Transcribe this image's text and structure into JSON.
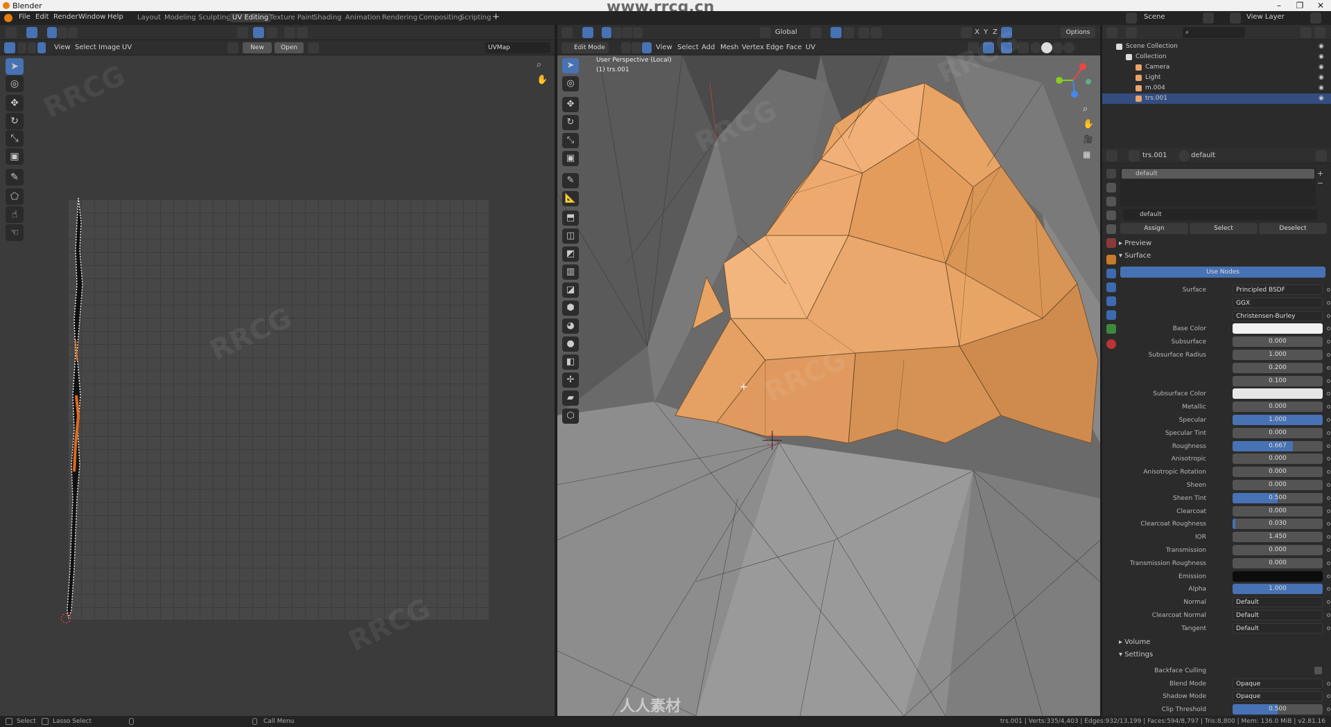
{
  "window": {
    "title": "Blender",
    "watermark_url": "www.rrcg.cn",
    "watermark_bottom": "人人素材"
  },
  "menu": [
    "File",
    "Edit",
    "Render",
    "Window",
    "Help"
  ],
  "workspaces": [
    {
      "label": "Layout",
      "active": false
    },
    {
      "label": "Modeling",
      "active": false
    },
    {
      "label": "Sculpting",
      "active": false
    },
    {
      "label": "UV Editing",
      "active": true
    },
    {
      "label": "Texture Paint",
      "active": false
    },
    {
      "label": "Shading",
      "active": false
    },
    {
      "label": "Animation",
      "active": false
    },
    {
      "label": "Rendering",
      "active": false
    },
    {
      "label": "Compositing",
      "active": false
    },
    {
      "label": "Scripting",
      "active": false
    }
  ],
  "scene": {
    "name": "Scene",
    "view_layer": "View Layer"
  },
  "uv_editor": {
    "menus": [
      "View",
      "Select",
      "Image",
      "UV"
    ],
    "new_label": "New",
    "open_label": "Open",
    "uvmap": "UVMap"
  },
  "viewport": {
    "mode": "Edit Mode",
    "menus": [
      "View",
      "Select",
      "Add",
      "Mesh",
      "Vertex",
      "Edge",
      "Face",
      "UV"
    ],
    "orientation": "Global",
    "options_label": "Options",
    "overlay_title": "User Perspective (Local)",
    "overlay_object": "(1) trs.001",
    "axes": {
      "x": "X",
      "y": "Y",
      "z": "Z"
    }
  },
  "outliner": {
    "items": [
      {
        "label": "Scene Collection",
        "indent": 0,
        "selected": false,
        "icon": "collection-icon"
      },
      {
        "label": "Collection",
        "indent": 1,
        "selected": false,
        "icon": "collection-icon"
      },
      {
        "label": "Camera",
        "indent": 2,
        "selected": false,
        "icon": "camera-icon"
      },
      {
        "label": "Light",
        "indent": 2,
        "selected": false,
        "icon": "light-icon"
      },
      {
        "label": "m.004",
        "indent": 2,
        "selected": false,
        "icon": "mesh-icon"
      },
      {
        "label": "trs.001",
        "indent": 2,
        "selected": true,
        "icon": "mesh-icon"
      }
    ]
  },
  "properties": {
    "object": "trs.001",
    "material": "default",
    "slot_name": "default",
    "material_field": "default",
    "buttons": {
      "assign": "Assign",
      "select": "Select",
      "deselect": "Deselect"
    },
    "sections": {
      "preview": "Preview",
      "surface": "Surface",
      "volume": "Volume",
      "settings": "Settings"
    },
    "use_nodes": "Use Nodes",
    "rows": [
      {
        "label": "Surface",
        "value": "Principled BSDF",
        "kind": "drop"
      },
      {
        "label": "",
        "value": "GGX",
        "kind": "drop"
      },
      {
        "label": "",
        "value": "Christensen-Burley",
        "kind": "drop"
      },
      {
        "label": "Base Color",
        "value": "",
        "kind": "swatch-w"
      },
      {
        "label": "Subsurface",
        "value": "0.000",
        "kind": "num",
        "fill": 0
      },
      {
        "label": "Subsurface Radius",
        "value": "1.000",
        "kind": "num",
        "fill": 0
      },
      {
        "label": "",
        "value": "0.200",
        "kind": "num",
        "fill": 0
      },
      {
        "label": "",
        "value": "0.100",
        "kind": "num",
        "fill": 0
      },
      {
        "label": "Subsurface Color",
        "value": "",
        "kind": "swatch-l"
      },
      {
        "label": "Metallic",
        "value": "0.000",
        "kind": "num",
        "fill": 0
      },
      {
        "label": "Specular",
        "value": "1.000",
        "kind": "num",
        "fill": 1
      },
      {
        "label": "Specular Tint",
        "value": "0.000",
        "kind": "num",
        "fill": 0
      },
      {
        "label": "Roughness",
        "value": "0.667",
        "kind": "num",
        "fill": 0.667
      },
      {
        "label": "Anisotropic",
        "value": "0.000",
        "kind": "num",
        "fill": 0
      },
      {
        "label": "Anisotropic Rotation",
        "value": "0.000",
        "kind": "num",
        "fill": 0
      },
      {
        "label": "Sheen",
        "value": "0.000",
        "kind": "num",
        "fill": 0
      },
      {
        "label": "Sheen Tint",
        "value": "0.500",
        "kind": "num",
        "fill": 0.5
      },
      {
        "label": "Clearcoat",
        "value": "0.000",
        "kind": "num",
        "fill": 0
      },
      {
        "label": "Clearcoat Roughness",
        "value": "0.030",
        "kind": "num",
        "fill": 0.03
      },
      {
        "label": "IOR",
        "value": "1.450",
        "kind": "num",
        "fill": 0
      },
      {
        "label": "Transmission",
        "value": "0.000",
        "kind": "num",
        "fill": 0
      },
      {
        "label": "Transmission Roughness",
        "value": "0.000",
        "kind": "num",
        "fill": 0
      },
      {
        "label": "Emission",
        "value": "",
        "kind": "swatch-b"
      },
      {
        "label": "Alpha",
        "value": "1.000",
        "kind": "num",
        "fill": 1
      },
      {
        "label": "Normal",
        "value": "Default",
        "kind": "drop"
      },
      {
        "label": "Clearcoat Normal",
        "value": "Default",
        "kind": "drop"
      },
      {
        "label": "Tangent",
        "value": "Default",
        "kind": "drop"
      }
    ],
    "settings": [
      {
        "label": "Backface Culling",
        "value": "",
        "kind": "check"
      },
      {
        "label": "Blend Mode",
        "value": "Opaque",
        "kind": "drop"
      },
      {
        "label": "Shadow Mode",
        "value": "Opaque",
        "kind": "drop"
      },
      {
        "label": "Clip Threshold",
        "value": "0.500",
        "kind": "num",
        "fill": 0.5
      }
    ]
  },
  "statusbar": {
    "left": [
      "Select",
      "Lasso Select"
    ],
    "middle": "Call Menu",
    "right": "trs.001 | Verts:335/4,403 | Edges:932/13,199 | Faces:594/8,797 | Tris:8,800 | Mem: 136.0 MiB | v2.81.16"
  },
  "colors": {
    "accent": "#4772b3",
    "selection_orange": "#e8a465",
    "mesh_gray": "#8a8a8a"
  }
}
